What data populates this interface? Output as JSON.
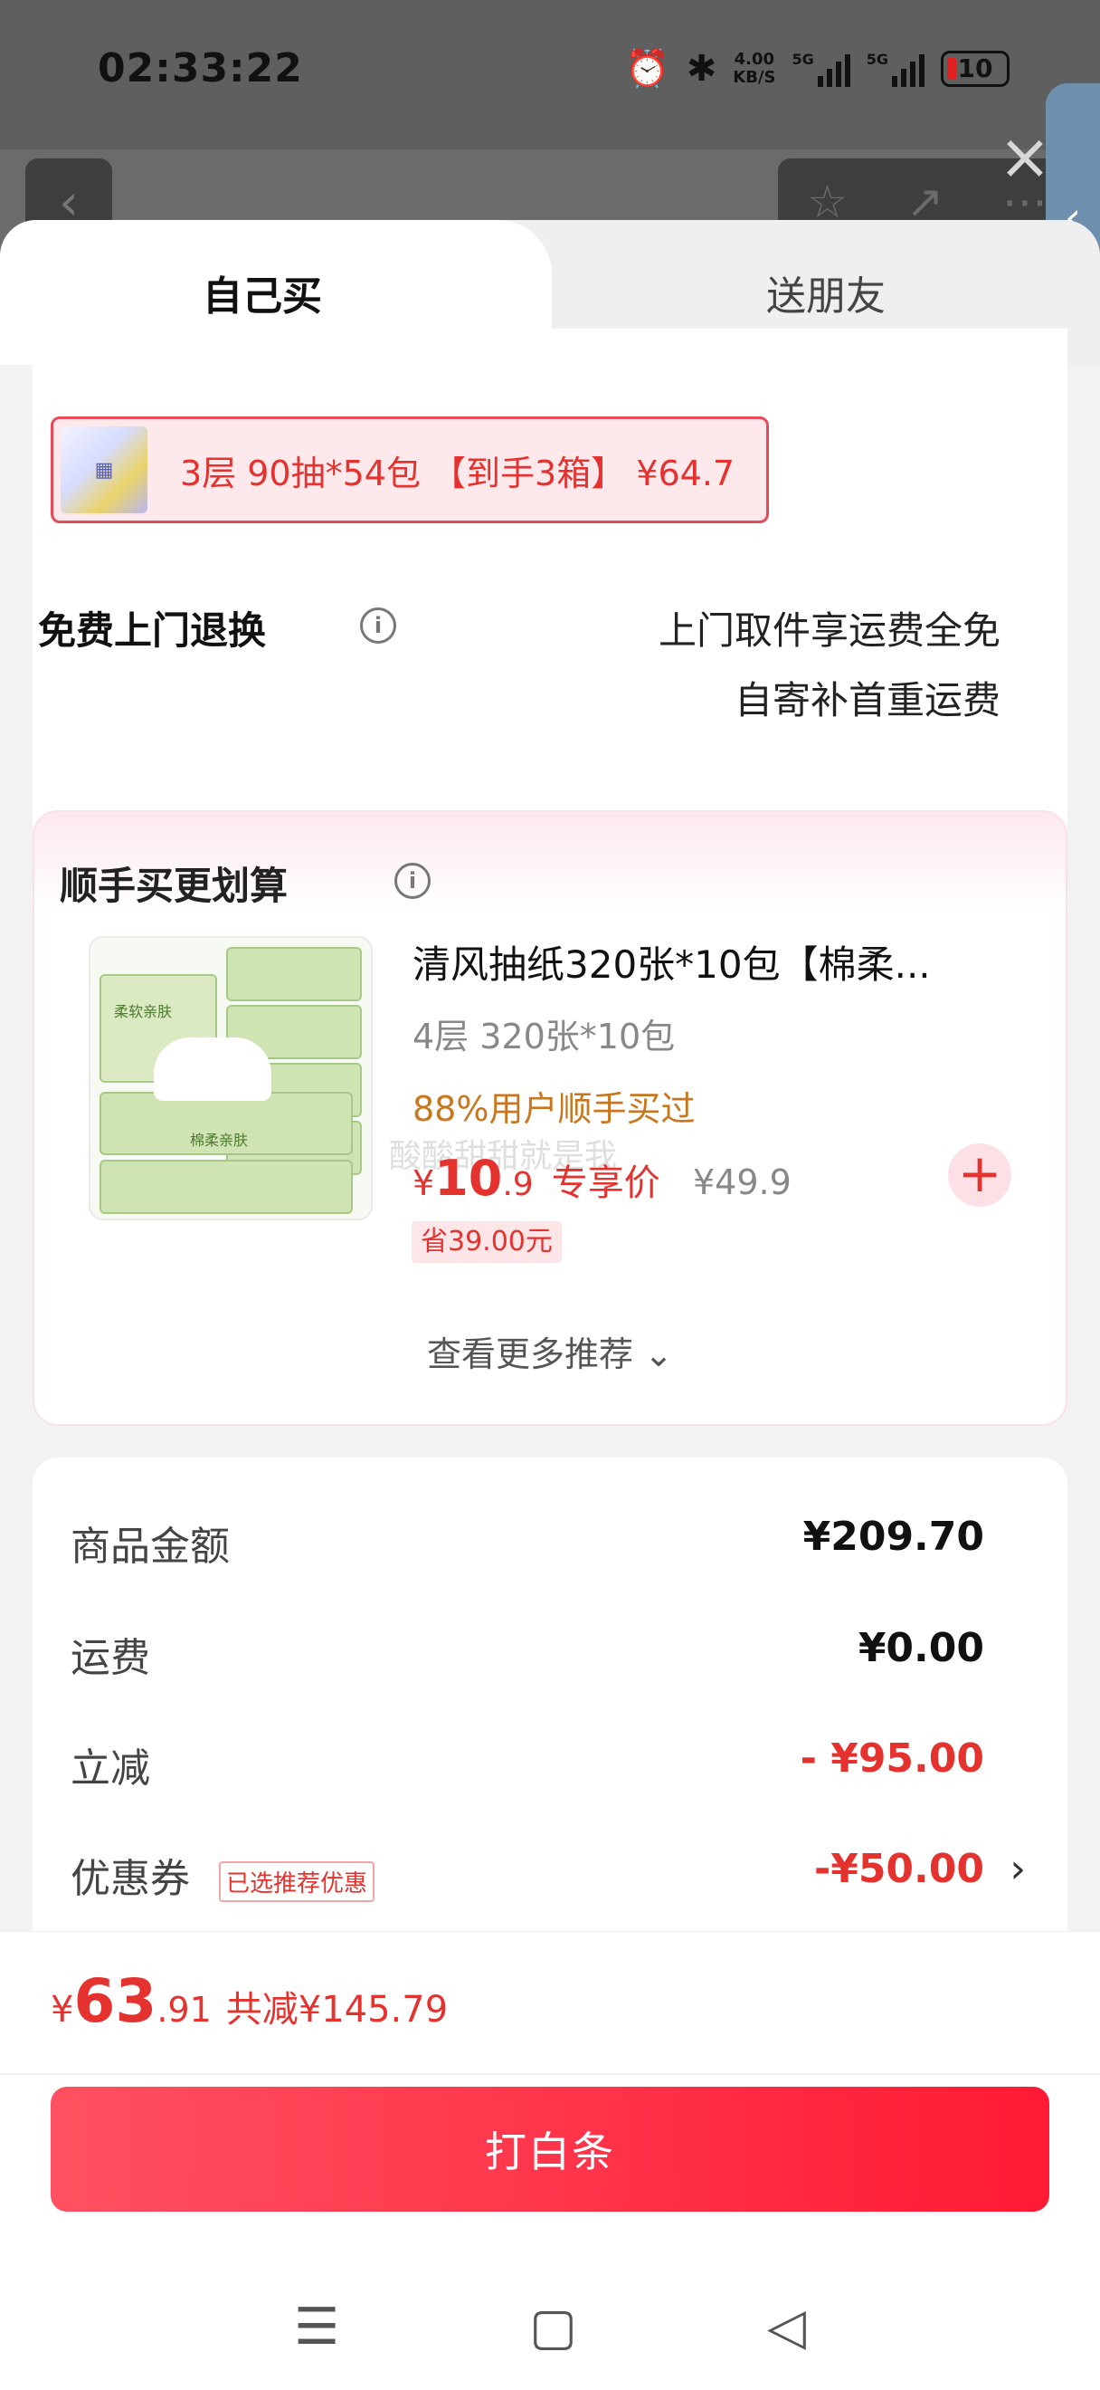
{
  "status_bar": {
    "time": "02:33:22",
    "net_speed": "4.00",
    "net_speed_unit": "KB/S",
    "sig1_label": "5G",
    "sig2_label": "5G",
    "battery": "10"
  },
  "tabs": {
    "active": "自己买",
    "inactive": "送朋友"
  },
  "variant": {
    "text": "3层 90抽*54包 【到手3箱】 ¥64.7"
  },
  "return_service": {
    "title": "免费上门退换",
    "line1": "上门取件享运费全免",
    "line2": "自寄补首重运费"
  },
  "recommend": {
    "title": "顺手买更划算",
    "product": {
      "name": "清风抽纸320张*10包【棉柔...",
      "spec": "4层 320张*10包",
      "bought": "88%用户顺手买过",
      "price_yen": "¥",
      "price_int": "10",
      "price_dec": ".9",
      "price_label": "专享价",
      "orig_price": "¥49.9",
      "save": "省39.00元",
      "img_label_1": "柔软亲肤",
      "img_label_2": "棉柔亲肤"
    },
    "watermark": "酸酸甜甜就是我",
    "more": "查看更多推荐 ⌄"
  },
  "summary": {
    "goods_label": "商品金额",
    "goods_value": "¥209.70",
    "shipping_label": "运费",
    "shipping_value": "¥0.00",
    "discount_label": "立减",
    "discount_value": "- ¥95.00",
    "coupon_label": "优惠券",
    "coupon_tag": "已选推荐优惠",
    "coupon_value": "-¥50.00",
    "coupon_chevron": "›"
  },
  "bottom": {
    "yen": "¥",
    "total_int": "63",
    "total_dec": ".91",
    "total_save": "共减¥145.79",
    "pay_button": "打白条"
  },
  "colors": {
    "accent": "#e4322f",
    "button_start": "#ff5161",
    "button_end": "#ff1a35",
    "bought_text": "#c9771e"
  }
}
